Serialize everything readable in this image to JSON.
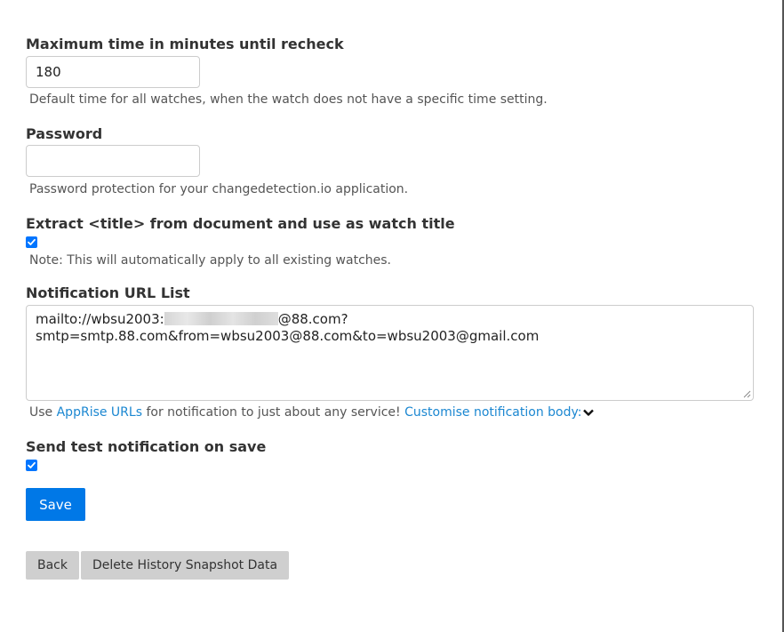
{
  "recheck": {
    "label": "Maximum time in minutes until recheck",
    "value": "180",
    "help": "Default time for all watches, when the watch does not have a specific time setting."
  },
  "password": {
    "label": "Password",
    "value": "",
    "help": "Password protection for your changedetection.io application."
  },
  "extract_title": {
    "label": "Extract <title> from document and use as watch title",
    "checked": true,
    "help": "Note: This will automatically apply to all existing watches."
  },
  "notification_urls": {
    "label": "Notification URL List",
    "line1_prefix": "mailto://wbsu2003:",
    "line1_suffix": "@88.com?",
    "line2": "smtp=smtp.88.com&from=wbsu2003@88.com&to=wbsu2003@gmail.com",
    "help_prefix": "Use ",
    "help_link": "AppRise URLs",
    "help_middle": " for notification to just about any service! ",
    "help_link2": "Customise notification body:"
  },
  "send_test": {
    "label": "Send test notification on save",
    "checked": true
  },
  "buttons": {
    "save": "Save",
    "back": "Back",
    "delete": "Delete History Snapshot Data"
  },
  "colors": {
    "primary": "#0078e7",
    "link": "#1b87d1",
    "checkbox": "#0075ff",
    "secondary_button": "#cfcfcf"
  }
}
